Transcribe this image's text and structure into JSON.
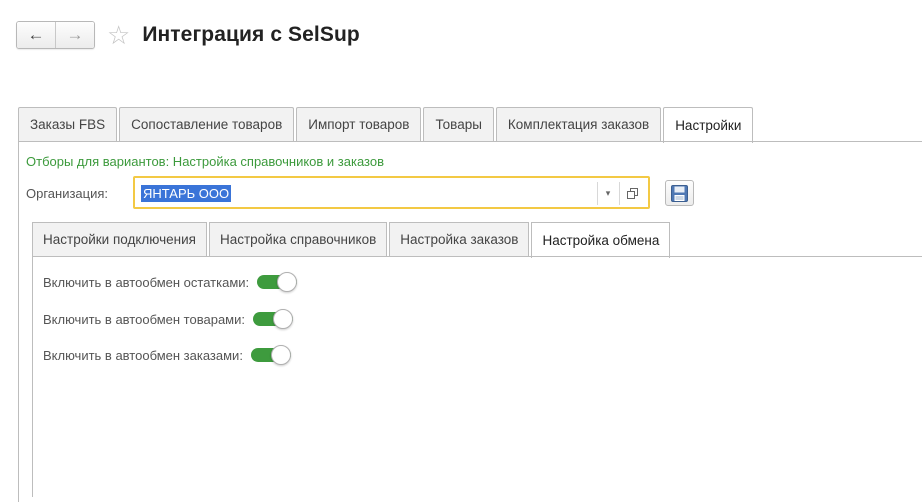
{
  "header": {
    "back_icon": "←",
    "forward_icon": "→",
    "star_icon": "☆",
    "title": "Интеграция с SelSup"
  },
  "main_tabs": [
    {
      "label": "Заказы FBS"
    },
    {
      "label": "Сопоставление товаров"
    },
    {
      "label": "Импорт товаров"
    },
    {
      "label": "Товары"
    },
    {
      "label": "Комплектация заказов"
    },
    {
      "label": "Настройки",
      "active": true
    }
  ],
  "filters_link": "Отборы для вариантов: Настройка справочников и заказов",
  "organization": {
    "label": "Организация:",
    "value": "ЯНТАРЬ ООО",
    "dropdown_icon": "▾"
  },
  "sub_tabs": [
    {
      "label": "Настройки подключения"
    },
    {
      "label": "Настройка справочников"
    },
    {
      "label": "Настройка заказов"
    },
    {
      "label": "Настройка обмена",
      "active": true
    }
  ],
  "toggles": [
    {
      "label": "Включить в автообмен остатками:",
      "on": true
    },
    {
      "label": "Включить в автообмен товарами:",
      "on": true
    },
    {
      "label": "Включить в автообмен заказами:",
      "on": true
    }
  ],
  "colors": {
    "accent_green": "#3e9b3e",
    "link_green": "#3c9a3c",
    "focus_yellow": "#f3c944",
    "selection_blue": "#3a74d8"
  }
}
